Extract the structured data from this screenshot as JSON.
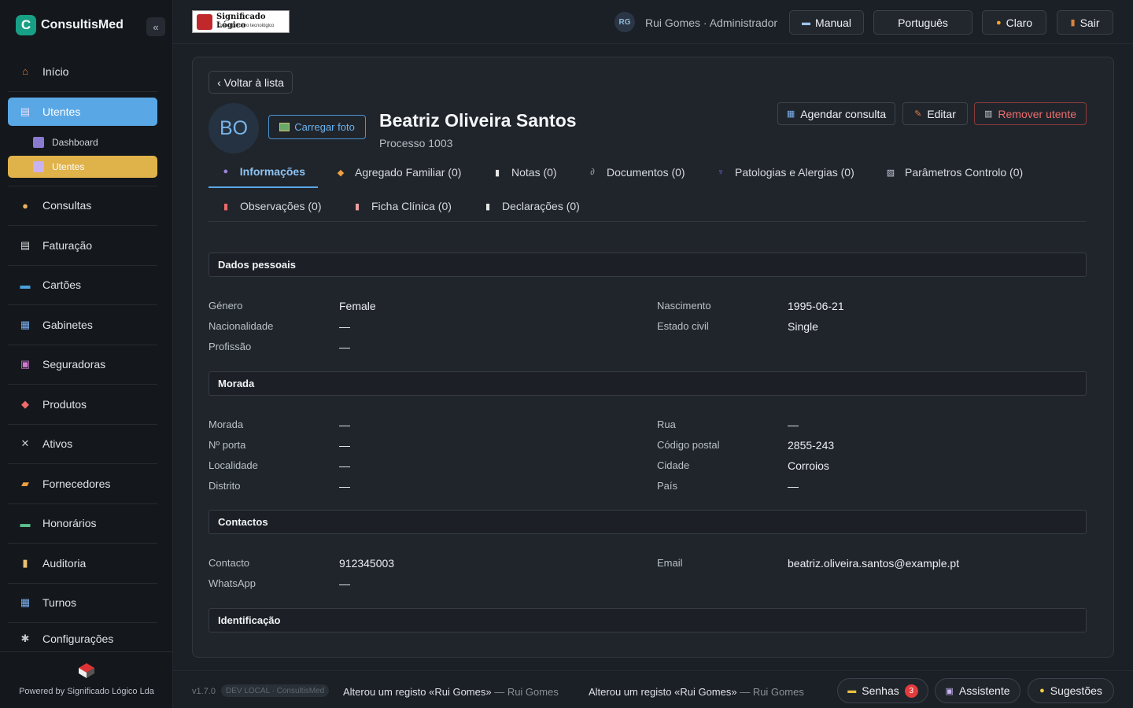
{
  "brand": {
    "logo_letter": "C",
    "name": "ConsultisMed",
    "collapse": "«"
  },
  "nav": {
    "items": [
      {
        "label": "Início",
        "icon": "home-icon",
        "glyph": "⌂",
        "color": "#e07a3a"
      },
      {
        "label": "Utentes",
        "icon": "users-icon",
        "glyph": "▤",
        "color": "#c9b2f0"
      },
      {
        "label": "Consultas",
        "icon": "doctor-icon",
        "glyph": "●",
        "color": "#e8b35a"
      },
      {
        "label": "Faturação",
        "icon": "receipt-icon",
        "glyph": "▤",
        "color": "#dcdcdc"
      },
      {
        "label": "Cartões",
        "icon": "card-icon",
        "glyph": "▬",
        "color": "#4aa3df"
      },
      {
        "label": "Gabinetes",
        "icon": "calendar-icon",
        "glyph": "▦",
        "color": "#7ab0f0"
      },
      {
        "label": "Seguradoras",
        "icon": "insurance-icon",
        "glyph": "▣",
        "color": "#d07ad0"
      },
      {
        "label": "Produtos",
        "icon": "pill-icon",
        "glyph": "◆",
        "color": "#f06a6a"
      },
      {
        "label": "Ativos",
        "icon": "tools-icon",
        "glyph": "✕",
        "color": "#c6cbd2"
      },
      {
        "label": "Fornecedores",
        "icon": "truck-icon",
        "glyph": "▰",
        "color": "#f0a040"
      },
      {
        "label": "Honorários",
        "icon": "money-icon",
        "glyph": "▬",
        "color": "#5ac08a"
      },
      {
        "label": "Auditoria",
        "icon": "scroll-icon",
        "glyph": "▮",
        "color": "#f0c070"
      },
      {
        "label": "Turnos",
        "icon": "calendar-icon",
        "glyph": "▦",
        "color": "#7ab0f0"
      },
      {
        "label": "Configurações",
        "icon": "gear-icon",
        "glyph": "✱",
        "color": "#c6cbd2"
      }
    ],
    "sub_items": [
      {
        "label": "Dashboard",
        "icon": "chart-icon"
      },
      {
        "label": "Utentes",
        "icon": "users-icon"
      }
    ]
  },
  "footer": {
    "powered": "Powered by Significado Lógico Lda"
  },
  "topbar": {
    "company_name": "Significado Lógico",
    "company_tagline": "O seu parceiro tecnológico",
    "user_initials": "RG",
    "user_label": "Rui Gomes · Administrador",
    "manual": "Manual",
    "language": "Português",
    "theme": "Claro",
    "logout": "Sair"
  },
  "patient": {
    "back": "‹ Voltar à lista",
    "initials": "BO",
    "upload": "Carregar foto",
    "name": "Beatriz Oliveira Santos",
    "process": "Processo 1003",
    "schedule": "Agendar consulta",
    "edit": "Editar",
    "remove": "Remover utente"
  },
  "tabs": [
    {
      "label": "Informações",
      "icon": "user-icon",
      "glyph": "●"
    },
    {
      "label": "Agregado Familiar (0)",
      "icon": "family-icon",
      "glyph": "◆"
    },
    {
      "label": "Notas (0)",
      "icon": "note-icon",
      "glyph": "▮"
    },
    {
      "label": "Documentos (0)",
      "icon": "paperclip-icon",
      "glyph": "∂"
    },
    {
      "label": "Patologias e Alergias (0)",
      "icon": "stethoscope-icon",
      "glyph": "♆"
    },
    {
      "label": "Parâmetros Controlo (0)",
      "icon": "chart-icon",
      "glyph": "▨"
    },
    {
      "label": "Observações (0)",
      "icon": "memo-icon",
      "glyph": "▮"
    },
    {
      "label": "Ficha Clínica (0)",
      "icon": "clipboard-icon",
      "glyph": "▮"
    },
    {
      "label": "Declarações (0)",
      "icon": "document-icon",
      "glyph": "▮"
    }
  ],
  "sections": {
    "personal": {
      "title": "Dados pessoais",
      "genero_label": "Género",
      "genero": "Female",
      "nascimento_label": "Nascimento",
      "nascimento": "1995-06-21",
      "nacionalidade_label": "Nacionalidade",
      "nacionalidade": "—",
      "estado_civil_label": "Estado civil",
      "estado_civil": "Single",
      "profissao_label": "Profissão",
      "profissao": "—"
    },
    "address": {
      "title": "Morada",
      "morada_label": "Morada",
      "morada": "—",
      "rua_label": "Rua",
      "rua": "—",
      "porta_label": "Nº porta",
      "porta": "—",
      "codigo_postal_label": "Código postal",
      "codigo_postal": "2855-243",
      "localidade_label": "Localidade",
      "localidade": "—",
      "cidade_label": "Cidade",
      "cidade": "Corroios",
      "distrito_label": "Distrito",
      "distrito": "—",
      "pais_label": "País",
      "pais": "—"
    },
    "contacts": {
      "title": "Contactos",
      "contacto_label": "Contacto",
      "contacto": "912345003",
      "email_label": "Email",
      "email": "beatriz.oliveira.santos@example.pt",
      "whatsapp_label": "WhatsApp",
      "whatsapp": "—"
    },
    "identification": {
      "title": "Identificação"
    }
  },
  "bottombar": {
    "version": "v1.7.0",
    "env": "DEV LOCAL · ConsultisMed",
    "activity_1": "Alterou um registo «Rui Gomes»",
    "activity_1_who": " — Rui Gomes",
    "activity_2": "Alterou um registo «Rui Gomes»",
    "activity_2_who": " — Rui Gomes",
    "senhas": "Senhas",
    "senhas_count": "3",
    "assistente": "Assistente",
    "sugestoes": "Sugestões"
  }
}
